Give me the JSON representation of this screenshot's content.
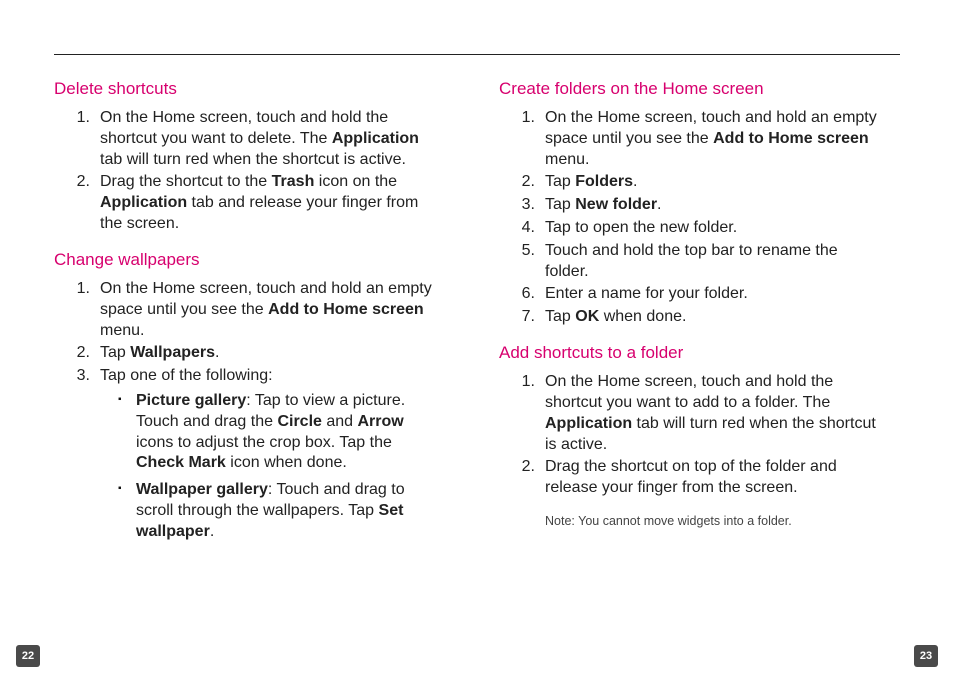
{
  "page_left": "22",
  "page_right": "23",
  "left": {
    "s1": {
      "title": "Delete shortcuts",
      "li1_a": "On the Home screen, touch and hold the shortcut you want to delete. The ",
      "li1_b": "Application",
      "li1_c": " tab will turn red when the shortcut is active.",
      "li2_a": "Drag the shortcut to the ",
      "li2_b": "Trash",
      "li2_c": " icon on the ",
      "li2_d": "Application",
      "li2_e": " tab and release your finger from the screen."
    },
    "s2": {
      "title": "Change wallpapers",
      "li1_a": "On the Home screen, touch and hold an empty space until you see the ",
      "li1_b": "Add to Home screen",
      "li1_c": " menu.",
      "li2_a": "Tap ",
      "li2_b": "Wallpapers",
      "li2_c": ".",
      "li3": "Tap one of the following:",
      "b1_a": "Picture gallery",
      "b1_b": ": Tap to view a picture. Touch and drag the ",
      "b1_c": "Circle",
      "b1_d": " and ",
      "b1_e": "Arrow",
      "b1_f": " icons to adjust the crop box. Tap the ",
      "b1_g": "Check Mark",
      "b1_h": " icon when done.",
      "b2_a": "Wallpaper gallery",
      "b2_b": ": Touch and drag to scroll through the wallpapers. Tap ",
      "b2_c": "Set wallpaper",
      "b2_d": "."
    }
  },
  "right": {
    "s1": {
      "title": "Create folders on the Home screen",
      "li1_a": "On the Home screen, touch and hold an empty space until you see the ",
      "li1_b": "Add to Home screen",
      "li1_c": " menu.",
      "li2_a": "Tap ",
      "li2_b": "Folders",
      "li2_c": ".",
      "li3_a": "Tap ",
      "li3_b": "New folder",
      "li3_c": ".",
      "li4": "Tap to open the new folder.",
      "li5": "Touch and hold the top bar to rename the folder.",
      "li6": "Enter a name for your folder.",
      "li7_a": "Tap ",
      "li7_b": "OK",
      "li7_c": " when done."
    },
    "s2": {
      "title": "Add shortcuts to a folder",
      "li1_a": "On the Home screen, touch and hold the shortcut you want to add to a folder. The ",
      "li1_b": "Application",
      "li1_c": " tab will turn red when the shortcut is active.",
      "li2": "Drag the shortcut on top of the folder and release your finger from the screen.",
      "note": "Note: You cannot move widgets into a folder."
    }
  }
}
